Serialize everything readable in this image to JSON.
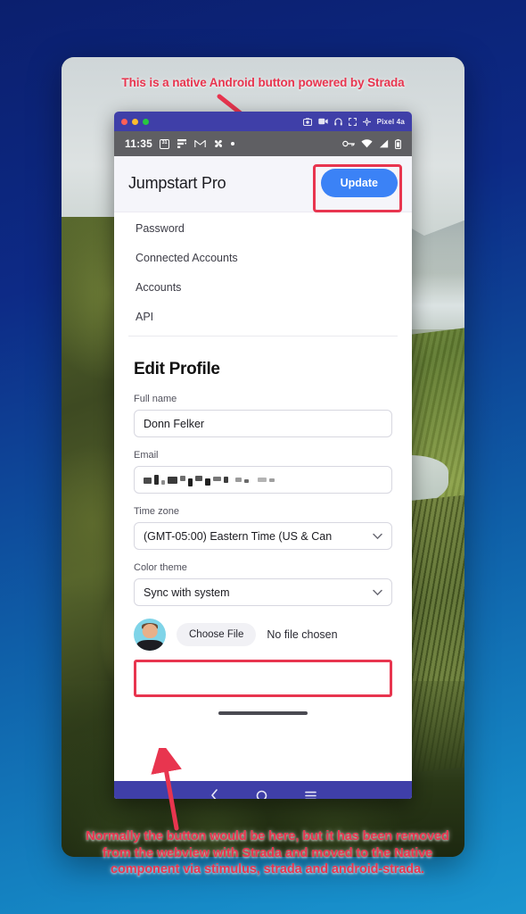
{
  "annotations": {
    "top": "This is a native Android button powered by Strada",
    "bottom_lines": [
      "Normally the button would be here, but it has been removed",
      "from the webview with Strada and moved to the Native",
      "component via stimulus, strada and android-strada."
    ],
    "color": "#e8354f"
  },
  "emulator": {
    "device_name": "Pixel 4a",
    "title_icons": [
      "camera-icon",
      "video-record-icon",
      "headphones-icon",
      "fullscreen-icon",
      "settings-gear-icon"
    ],
    "traffic_lights": [
      "close",
      "minimize",
      "zoom"
    ],
    "accent_color": "#3f3fa8"
  },
  "status_bar": {
    "time": "11:35",
    "calendar_day": "31",
    "left_icons": [
      "calendar-icon",
      "figma-icon",
      "gmail-icon",
      "pinwheel-icon",
      "dot-icon"
    ],
    "right_icons": [
      "vpn-key-icon",
      "wifi-icon",
      "cell-signal-icon",
      "battery-icon"
    ]
  },
  "app": {
    "title": "Jumpstart Pro",
    "update_button": "Update",
    "update_button_color": "#3b82f6",
    "menu_items": [
      {
        "label": "Password"
      },
      {
        "label": "Connected Accounts"
      },
      {
        "label": "Accounts"
      },
      {
        "label": "API"
      }
    ]
  },
  "form": {
    "heading": "Edit Profile",
    "full_name": {
      "label": "Full name",
      "value": "Donn Felker"
    },
    "email": {
      "label": "Email",
      "value": "",
      "redacted": true
    },
    "time_zone": {
      "label": "Time zone",
      "value": "(GMT-05:00) Eastern Time (US & Can"
    },
    "color_theme": {
      "label": "Color theme",
      "value": "Sync with system"
    },
    "avatar_file": {
      "button": "Choose File",
      "status": "No file chosen"
    }
  },
  "nav_bar": {
    "items": [
      "back-icon",
      "home-icon",
      "recents-icon"
    ]
  }
}
